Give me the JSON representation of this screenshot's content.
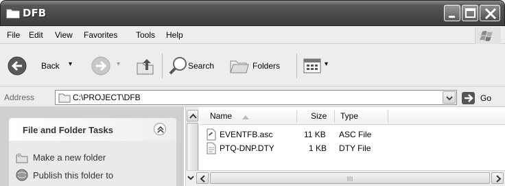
{
  "window": {
    "title": "DFB"
  },
  "menu": {
    "items": [
      {
        "label": "File"
      },
      {
        "label": "Edit"
      },
      {
        "label": "View"
      },
      {
        "label": "Favorites"
      },
      {
        "label": "Tools"
      },
      {
        "label": "Help"
      }
    ]
  },
  "toolbar": {
    "back_label": "Back",
    "search_label": "Search",
    "folders_label": "Folders"
  },
  "address": {
    "label": "Address",
    "value": "C:\\PROJECT\\DFB",
    "go_label": "Go"
  },
  "taskpane": {
    "title": "File and Folder Tasks",
    "links": [
      {
        "label": "Make a new folder"
      },
      {
        "label": "Publish this folder to"
      }
    ]
  },
  "filelist": {
    "columns": [
      {
        "label": "Name"
      },
      {
        "label": "Size"
      },
      {
        "label": "Type"
      }
    ],
    "rows": [
      {
        "name": "EVENTFB.asc",
        "size": "11 KB",
        "type": "ASC File"
      },
      {
        "name": "PTQ-DNP.DTY",
        "size": "1 KB",
        "type": "DTY File"
      }
    ]
  }
}
